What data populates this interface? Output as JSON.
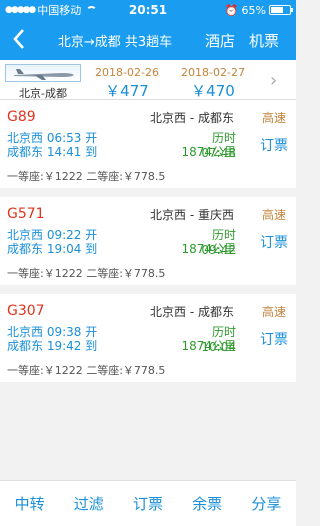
{
  "status": {
    "carrier": "中国移动",
    "time": "20:51",
    "battery": "65%",
    "battery_level": 0.65
  },
  "nav": {
    "title": "北京→成都 共3趟车",
    "hotel": "酒店",
    "flight": "机票"
  },
  "datebar": {
    "route": "北京-成都",
    "dates": [
      {
        "date": "2018-02-26",
        "price": "￥477"
      },
      {
        "date": "2018-02-27",
        "price": "￥470"
      }
    ]
  },
  "trains": [
    {
      "no": "G89",
      "route": "北京西 - 成都东",
      "type": "高速",
      "dep": "北京西 06:53 开",
      "arr": "成都东 14:41 到",
      "duration": "历时 07:48",
      "distance": "1874公里",
      "book": "订票",
      "price": "一等座:￥1222 二等座:￥778.5"
    },
    {
      "no": "G571",
      "route": "北京西 - 重庆西",
      "type": "高速",
      "dep": "北京西 09:22 开",
      "arr": "成都东 19:04 到",
      "duration": "历时 09:42",
      "distance": "1874公里",
      "book": "订票",
      "price": "一等座:￥1222 二等座:￥778.5"
    },
    {
      "no": "G307",
      "route": "北京西 - 成都东",
      "type": "高速",
      "dep": "北京西 09:38 开",
      "arr": "成都东 19:42 到",
      "duration": "历时 10:04",
      "distance": "1874公里",
      "book": "订票",
      "price": "一等座:￥1222 二等座:￥778.5"
    }
  ],
  "bottom": [
    "中转",
    "过滤",
    "订票",
    "余票",
    "分享"
  ]
}
